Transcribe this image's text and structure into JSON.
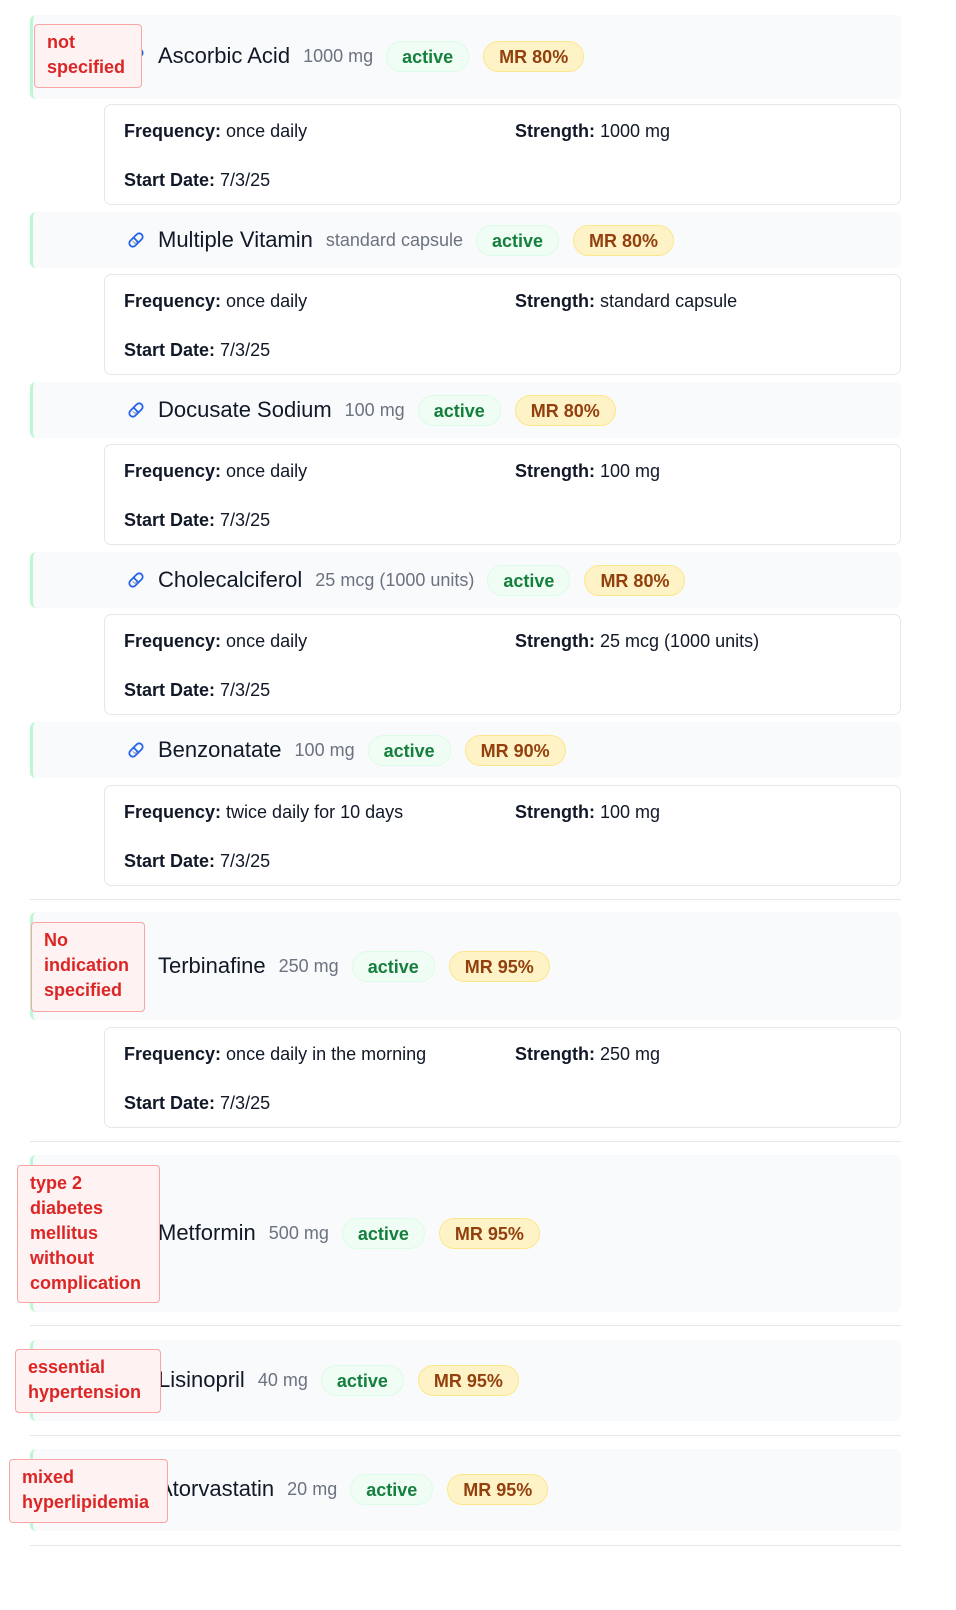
{
  "labels": {
    "frequency": "Frequency:",
    "strength": "Strength:",
    "start_date": "Start Date:"
  },
  "colors": {
    "active_text": "#15803d",
    "mr_text": "#92400e",
    "indication_text": "#dc2626",
    "row_accent": "#bbf7d0"
  },
  "meds": [
    {
      "name": "Ascorbic Acid",
      "dose": "1000 mg",
      "status": "active",
      "mr": "MR 80%",
      "indication": "not specified",
      "expanded": true,
      "frequency": "once daily",
      "strength": "1000 mg",
      "start_date": "7/3/25"
    },
    {
      "name": "Multiple Vitamin",
      "dose": "standard capsule",
      "status": "active",
      "mr": "MR 80%",
      "indication": "",
      "expanded": true,
      "frequency": "once daily",
      "strength": "standard capsule",
      "start_date": "7/3/25"
    },
    {
      "name": "Docusate Sodium",
      "dose": "100 mg",
      "status": "active",
      "mr": "MR 80%",
      "indication": "",
      "expanded": true,
      "frequency": "once daily",
      "strength": "100 mg",
      "start_date": "7/3/25"
    },
    {
      "name": "Cholecalciferol",
      "dose": "25 mcg (1000 units)",
      "status": "active",
      "mr": "MR 80%",
      "indication": "",
      "expanded": true,
      "frequency": "once daily",
      "strength": "25 mcg (1000 units)",
      "start_date": "7/3/25"
    },
    {
      "name": "Benzonatate",
      "dose": "100 mg",
      "status": "active",
      "mr": "MR 90%",
      "indication": "",
      "expanded": true,
      "frequency": "twice daily for 10 days",
      "strength": "100 mg",
      "start_date": "7/3/25"
    },
    {
      "name": "Terbinafine",
      "dose": "250 mg",
      "status": "active",
      "mr": "MR 95%",
      "indication": "No indication specified",
      "expanded": true,
      "frequency": "once daily in the morning",
      "strength": "250 mg",
      "start_date": "7/3/25"
    },
    {
      "name": "Metformin",
      "dose": "500 mg",
      "status": "active",
      "mr": "MR 95%",
      "indication": "type 2 diabetes mellitus without complication",
      "expanded": false
    },
    {
      "name": "Lisinopril",
      "dose": "40 mg",
      "status": "active",
      "mr": "MR 95%",
      "indication": "essential hypertension",
      "expanded": false
    },
    {
      "name": "Atorvastatin",
      "dose": "20 mg",
      "status": "active",
      "mr": "MR 95%",
      "indication": "mixed hyperlipidemia",
      "expanded": false
    }
  ]
}
